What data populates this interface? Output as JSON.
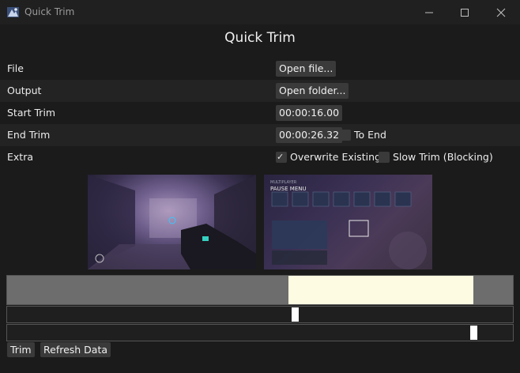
{
  "window": {
    "title": "Quick Trim",
    "minimize_icon": "minimize-icon",
    "maximize_icon": "maximize-icon",
    "close_icon": "close-icon"
  },
  "heading": "Quick Trim",
  "rows": {
    "file": {
      "label": "File",
      "button": "Open file..."
    },
    "output": {
      "label": "Output",
      "button": "Open folder..."
    },
    "start": {
      "label": "Start Trim",
      "value": "00:00:16.00"
    },
    "end": {
      "label": "End Trim",
      "value": "00:00:26.32",
      "to_end_label": "To End",
      "to_end_checked": false
    },
    "extra": {
      "label": "Extra",
      "overwrite_label": "Overwrite Existing",
      "overwrite_checked": true,
      "slow_label": "Slow Trim (Blocking)",
      "slow_checked": false
    }
  },
  "timeline": {
    "selection_start": 0.557,
    "selection_end": 0.922
  },
  "sliders": {
    "start_position": 0.563,
    "end_position": 0.915
  },
  "buttons": {
    "trim": "Trim",
    "refresh": "Refresh Data"
  },
  "colors": {
    "selection": "#fdfbe2",
    "track": "#6d6d6d",
    "handle": "#ffffff",
    "background": "#1b1b1b"
  }
}
